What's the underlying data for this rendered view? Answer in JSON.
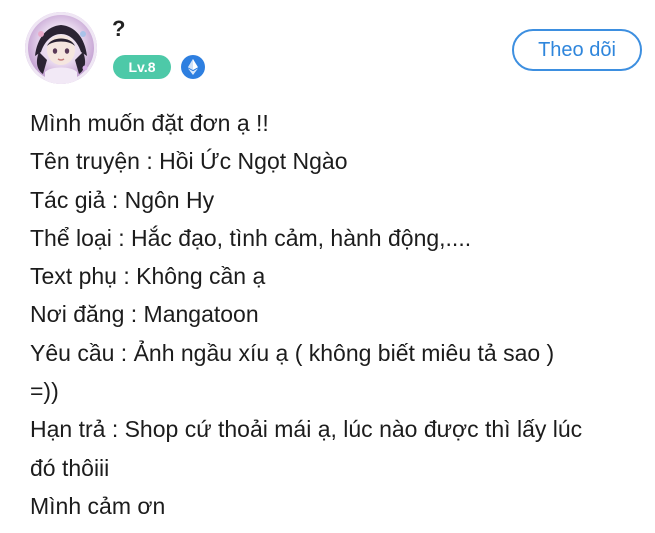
{
  "user": {
    "name": "?",
    "level": "Lv.8",
    "avatar_icon": "avatar-image",
    "badge_icon": "ethereum-icon"
  },
  "follow_button": {
    "label": "Theo dõi"
  },
  "post": {
    "lines": [
      "Mình muốn đặt đơn ạ !!",
      "Tên truyện : Hồi Ức Ngọt Ngào",
      "Tác giả : Ngôn Hy",
      "Thể loại : Hắc đạo, tình cảm, hành động,....",
      "Text phụ : Không cần ạ",
      "Nơi đăng : Mangatoon",
      "Yêu cầu : Ảnh ngầu xíu ạ ( không biết miêu tả sao )",
      "=))",
      "Hạn trả : Shop cứ thoải mái ạ, lúc nào được thì lấy lúc",
      "đó thôiii",
      "Mình cảm ơn"
    ]
  },
  "colors": {
    "accent_blue": "#2f86dc",
    "level_badge_green": "#4dc9a8",
    "text": "#1c1c1c"
  }
}
